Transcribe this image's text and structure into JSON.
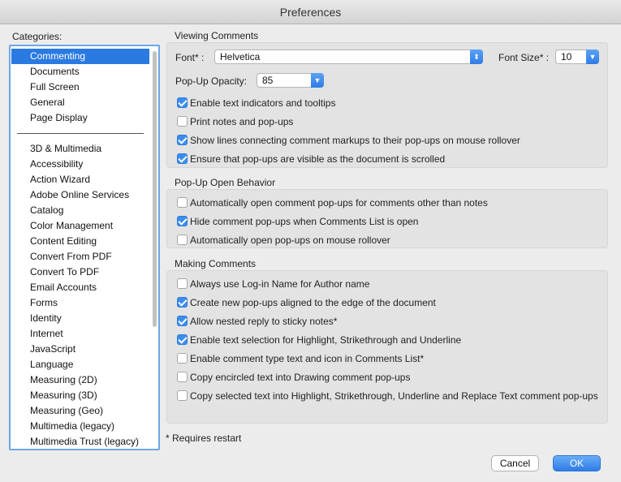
{
  "window": {
    "title": "Preferences"
  },
  "categories": {
    "label": "Categories:",
    "primary": [
      "Commenting",
      "Documents",
      "Full Screen",
      "General",
      "Page Display"
    ],
    "selected": "Commenting",
    "secondary": [
      "3D & Multimedia",
      "Accessibility",
      "Action Wizard",
      "Adobe Online Services",
      "Catalog",
      "Color Management",
      "Content Editing",
      "Convert From PDF",
      "Convert To PDF",
      "Email Accounts",
      "Forms",
      "Identity",
      "Internet",
      "JavaScript",
      "Language",
      "Measuring (2D)",
      "Measuring (3D)",
      "Measuring (Geo)",
      "Multimedia (legacy)",
      "Multimedia Trust (legacy)"
    ]
  },
  "viewing": {
    "title": "Viewing Comments",
    "font_label": "Font* :",
    "font_value": "Helvetica",
    "font_size_label": "Font Size* :",
    "font_size_value": "10",
    "opacity_label": "Pop-Up Opacity:",
    "opacity_value": "85",
    "options": [
      {
        "label": "Enable text indicators and tooltips",
        "checked": true
      },
      {
        "label": "Print notes and pop-ups",
        "checked": false
      },
      {
        "label": "Show lines connecting comment markups to their pop-ups on mouse rollover",
        "checked": true
      },
      {
        "label": "Ensure that pop-ups are visible as the document is scrolled",
        "checked": true
      }
    ]
  },
  "popup": {
    "title": "Pop-Up Open Behavior",
    "options": [
      {
        "label": "Automatically open comment pop-ups for comments other than notes",
        "checked": false
      },
      {
        "label": "Hide comment pop-ups when Comments List is open",
        "checked": true
      },
      {
        "label": "Automatically open pop-ups on mouse rollover",
        "checked": false
      }
    ]
  },
  "making": {
    "title": "Making Comments",
    "options": [
      {
        "label": "Always use Log-in Name for Author name",
        "checked": false
      },
      {
        "label": "Create new pop-ups aligned to the edge of the document",
        "checked": true
      },
      {
        "label": "Allow nested reply to sticky notes*",
        "checked": true
      },
      {
        "label": "Enable text selection for Highlight, Strikethrough and Underline",
        "checked": true
      },
      {
        "label": "Enable comment type text and icon in Comments List*",
        "checked": false
      },
      {
        "label": "Copy encircled text into Drawing comment pop-ups",
        "checked": false
      },
      {
        "label": "Copy selected text into Highlight, Strikethrough, Underline and Replace Text comment pop-ups",
        "checked": false
      }
    ]
  },
  "footnote": "* Requires restart",
  "buttons": {
    "cancel": "Cancel",
    "ok": "OK"
  },
  "colors": {
    "accent": "#2a7ae2",
    "group_bg": "#e3e3e3",
    "window_bg": "#ececec"
  }
}
